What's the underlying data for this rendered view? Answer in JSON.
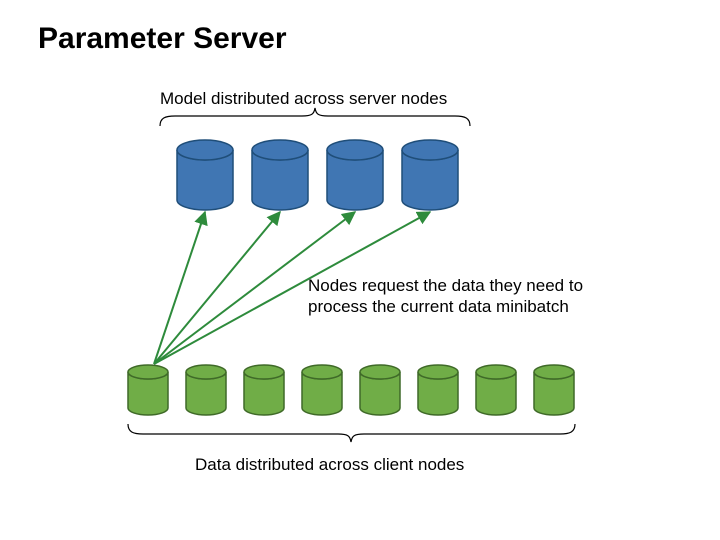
{
  "title": "Parameter Server",
  "labels": {
    "top": "Model distributed across server nodes",
    "mid": "Nodes request the data they need to process the current data minibatch",
    "bottom": "Data distributed across client nodes"
  },
  "chart_data": {
    "type": "diagram",
    "title": "Parameter Server",
    "server_nodes": {
      "count": 4,
      "color": "#4076B3",
      "stroke": "#1F4E79",
      "label": "Model distributed across server nodes"
    },
    "client_nodes": {
      "count": 8,
      "color": "#70AD47",
      "stroke": "#3F6A28",
      "label": "Data distributed across client nodes"
    },
    "arrows": {
      "from": "client_node_1",
      "to_all": "server_nodes",
      "color": "#2E8B3C",
      "label": "Nodes request the data they need to process the current data minibatch"
    }
  }
}
